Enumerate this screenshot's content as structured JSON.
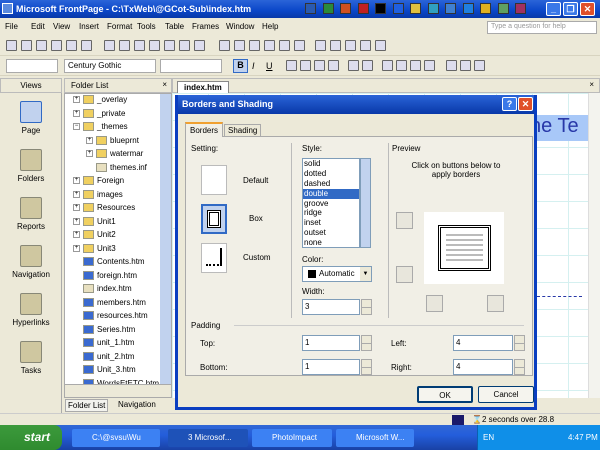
{
  "window": {
    "title": "Microsoft FrontPage - C:\\TxWeb\\@GCot-Sub\\index.htm",
    "minimize": "_",
    "restore": "❐",
    "close": "✕"
  },
  "menu": [
    "File",
    "Edit",
    "View",
    "Insert",
    "Format",
    "Tools",
    "Table",
    "Frames",
    "Window",
    "Help"
  ],
  "help_placeholder": "Type a question for help",
  "format_toolbar": {
    "style": "",
    "font": "Century Gothic",
    "size": "",
    "bold": "B",
    "italic": "I",
    "underline": "U"
  },
  "panels": {
    "views_title": "Views",
    "folder_title": "Folder List",
    "close": "×",
    "editor_tab": "index.htm"
  },
  "views": [
    {
      "label": "Page",
      "icon": "page-icon"
    },
    {
      "label": "Folders",
      "icon": "folders-icon"
    },
    {
      "label": "Reports",
      "icon": "reports-icon"
    },
    {
      "label": "Navigation",
      "icon": "navigation-icon"
    },
    {
      "label": "Hyperlinks",
      "icon": "hyperlinks-icon"
    },
    {
      "label": "Tasks",
      "icon": "tasks-icon"
    }
  ],
  "folder_list": [
    {
      "name": "_overlay",
      "type": "folder",
      "level": 0,
      "toggle": "+"
    },
    {
      "name": "_private",
      "type": "folder",
      "level": 0,
      "toggle": "+"
    },
    {
      "name": "_themes",
      "type": "folder",
      "level": 0,
      "toggle": "−"
    },
    {
      "name": "blueprnt",
      "type": "folder",
      "level": 1,
      "toggle": "+"
    },
    {
      "name": "watermar",
      "type": "folder",
      "level": 1,
      "toggle": "+"
    },
    {
      "name": "themes.inf",
      "type": "file",
      "level": 1,
      "toggle": ""
    },
    {
      "name": "Foreign",
      "type": "folder",
      "level": 0,
      "toggle": "+"
    },
    {
      "name": "images",
      "type": "folder",
      "level": 0,
      "toggle": "+"
    },
    {
      "name": "Resources",
      "type": "folder",
      "level": 0,
      "toggle": "+"
    },
    {
      "name": "Unit1",
      "type": "folder",
      "level": 0,
      "toggle": "+"
    },
    {
      "name": "Unit2",
      "type": "folder",
      "level": 0,
      "toggle": "+"
    },
    {
      "name": "Unit3",
      "type": "folder",
      "level": 0,
      "toggle": "+"
    },
    {
      "name": "Contents.htm",
      "type": "page",
      "level": 0,
      "toggle": ""
    },
    {
      "name": "foreign.htm",
      "type": "page",
      "level": 0,
      "toggle": ""
    },
    {
      "name": "index.htm",
      "type": "page-edit",
      "level": 0,
      "toggle": ""
    },
    {
      "name": "members.htm",
      "type": "page",
      "level": 0,
      "toggle": ""
    },
    {
      "name": "resources.htm",
      "type": "page",
      "level": 0,
      "toggle": ""
    },
    {
      "name": "Series.htm",
      "type": "page",
      "level": 0,
      "toggle": ""
    },
    {
      "name": "unit_1.htm",
      "type": "page",
      "level": 0,
      "toggle": ""
    },
    {
      "name": "unit_2.htm",
      "type": "page",
      "level": 0,
      "toggle": ""
    },
    {
      "name": "Unit_3.htm",
      "type": "page",
      "level": 0,
      "toggle": ""
    },
    {
      "name": "WordsEtETC.htm",
      "type": "page",
      "level": 0,
      "toggle": ""
    }
  ],
  "folder_tabs": {
    "folder_list": "Folder List",
    "navigation": "Navigation"
  },
  "editor": {
    "heading_fragment": "ne Te"
  },
  "dialog": {
    "title": "Borders and Shading",
    "help": "?",
    "close": "✕",
    "tabs": [
      "Borders",
      "Shading"
    ],
    "setting_label": "Setting:",
    "settings": [
      "Default",
      "Box",
      "Custom"
    ],
    "selected_setting": "Box",
    "style_label": "Style:",
    "styles": [
      "solid",
      "dotted",
      "dashed",
      "double",
      "groove",
      "ridge",
      "inset",
      "outset",
      "none"
    ],
    "selected_style": "double",
    "color_label": "Color:",
    "color_value": "Automatic",
    "color_swatch": "#000000",
    "width_label": "Width:",
    "width_value": "3",
    "preview_label": "Preview",
    "preview_hint": "Click on buttons below to apply borders",
    "padding_label": "Padding",
    "top_label": "Top:",
    "top_value": "1",
    "bottom_label": "Bottom:",
    "bottom_value": "1",
    "left_label": "Left:",
    "left_value": "4",
    "right_label": "Right:",
    "right_value": "4",
    "ok": "OK",
    "cancel": "Cancel"
  },
  "status": {
    "text": "2 seconds over 28.8"
  },
  "taskbar": {
    "start": "start",
    "tasks": [
      "C:\\@svsu\\Wu",
      "3 Microsof...",
      "PhotoImpact",
      "Microsoft W..."
    ],
    "lang": "EN",
    "clock": "4:47 PM"
  }
}
